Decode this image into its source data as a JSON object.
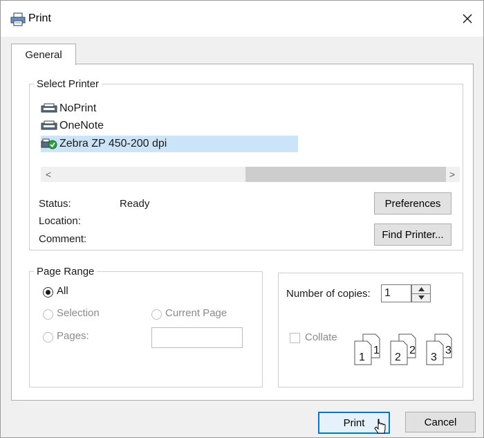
{
  "window": {
    "title": "Print"
  },
  "tabs": [
    {
      "label": "General"
    }
  ],
  "select_printer": {
    "legend": "Select Printer",
    "printers": [
      {
        "name": "NoPrint",
        "selected": false
      },
      {
        "name": "OneNote",
        "selected": false
      },
      {
        "name": "Zebra  ZP 450-200 dpi",
        "selected": true
      }
    ],
    "scroll_left": "<",
    "scroll_right": ">",
    "status_label": "Status:",
    "status_value": "Ready",
    "location_label": "Location:",
    "location_value": "",
    "comment_label": "Comment:",
    "comment_value": "",
    "preferences_button": "Preferences",
    "find_printer_button": "Find Printer..."
  },
  "page_range": {
    "legend": "Page Range",
    "all": "All",
    "selection": "Selection",
    "current_page": "Current Page",
    "pages": "Pages:",
    "pages_value": "",
    "selected_option": "All"
  },
  "copies": {
    "label": "Number of copies:",
    "value": "1",
    "collate": "Collate",
    "collate_checked": false,
    "collate_pages": [
      "1",
      "1",
      "2",
      "2",
      "3",
      "3"
    ]
  },
  "footer": {
    "print_button": "Print",
    "cancel_button": "Cancel"
  },
  "colors": {
    "selection": "#cce4f7",
    "default_button_border": "#0078d7",
    "window_bg": "#f0f0f0"
  }
}
